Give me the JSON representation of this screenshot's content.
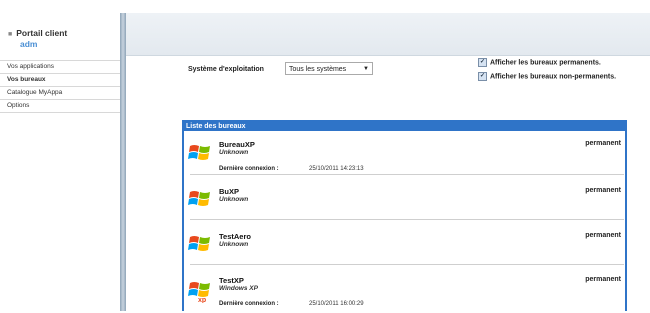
{
  "portal": {
    "title": "Portail client",
    "user": "adm"
  },
  "nav": [
    {
      "label": "Vos applications",
      "active": false
    },
    {
      "label": "Vos bureaux",
      "active": true
    },
    {
      "label": "Catalogue MyAppa",
      "active": false
    },
    {
      "label": "Options",
      "active": false
    }
  ],
  "filters": {
    "os_label": "Système d'exploitation",
    "os_value": "Tous les systèmes",
    "show_permanent": "Afficher les bureaux permanents.",
    "show_non_permanent": "Afficher les bureaux non-permanents."
  },
  "list": {
    "title": "Liste des bureaux",
    "conn_label": "Dernière connexion :",
    "items": [
      {
        "name": "BureauXP",
        "os": "Unknown",
        "last": "25/10/2011 14:23:13",
        "status": "permanent"
      },
      {
        "name": "BuXP",
        "os": "Unknown",
        "last": "",
        "status": "permanent"
      },
      {
        "name": "TestAero",
        "os": "Unknown",
        "last": "",
        "status": "permanent"
      },
      {
        "name": "TestXP",
        "os": "Windows XP",
        "last": "25/10/2011 16:00:29",
        "status": "permanent"
      }
    ]
  }
}
